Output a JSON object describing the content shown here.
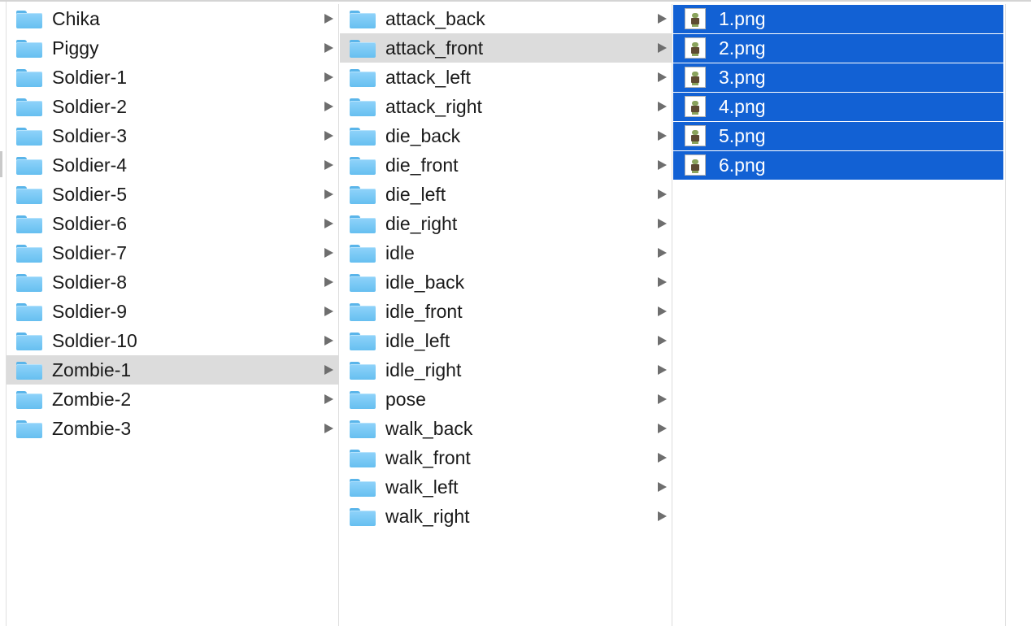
{
  "columns": {
    "col1": {
      "items": [
        {
          "label": "Chika",
          "selected": false
        },
        {
          "label": "Piggy",
          "selected": false
        },
        {
          "label": "Soldier-1",
          "selected": false
        },
        {
          "label": "Soldier-2",
          "selected": false
        },
        {
          "label": "Soldier-3",
          "selected": false
        },
        {
          "label": "Soldier-4",
          "selected": false
        },
        {
          "label": "Soldier-5",
          "selected": false
        },
        {
          "label": "Soldier-6",
          "selected": false
        },
        {
          "label": "Soldier-7",
          "selected": false
        },
        {
          "label": "Soldier-8",
          "selected": false
        },
        {
          "label": "Soldier-9",
          "selected": false
        },
        {
          "label": "Soldier-10",
          "selected": false
        },
        {
          "label": "Zombie-1",
          "selected": true
        },
        {
          "label": "Zombie-2",
          "selected": false
        },
        {
          "label": "Zombie-3",
          "selected": false
        }
      ]
    },
    "col2": {
      "items": [
        {
          "label": "attack_back",
          "selected": false
        },
        {
          "label": "attack_front",
          "selected": true
        },
        {
          "label": "attack_left",
          "selected": false
        },
        {
          "label": "attack_right",
          "selected": false
        },
        {
          "label": "die_back",
          "selected": false
        },
        {
          "label": "die_front",
          "selected": false
        },
        {
          "label": "die_left",
          "selected": false
        },
        {
          "label": "die_right",
          "selected": false
        },
        {
          "label": "idle",
          "selected": false
        },
        {
          "label": "idle_back",
          "selected": false
        },
        {
          "label": "idle_front",
          "selected": false
        },
        {
          "label": "idle_left",
          "selected": false
        },
        {
          "label": "idle_right",
          "selected": false
        },
        {
          "label": "pose",
          "selected": false
        },
        {
          "label": "walk_back",
          "selected": false
        },
        {
          "label": "walk_front",
          "selected": false
        },
        {
          "label": "walk_left",
          "selected": false
        },
        {
          "label": "walk_right",
          "selected": false
        }
      ]
    },
    "col3": {
      "items": [
        {
          "label": "1.png",
          "selected": true
        },
        {
          "label": "2.png",
          "selected": true
        },
        {
          "label": "3.png",
          "selected": true
        },
        {
          "label": "4.png",
          "selected": true
        },
        {
          "label": "5.png",
          "selected": true
        },
        {
          "label": "6.png",
          "selected": true
        }
      ]
    }
  },
  "icons": {
    "folder": "folder-icon",
    "disclosure": "disclosure-arrow-icon",
    "image_file": "png-file-icon"
  },
  "colors": {
    "selection_blue": "#1261d4",
    "selection_gray": "#dcdcdc",
    "folder_blue": "#66bff0"
  }
}
